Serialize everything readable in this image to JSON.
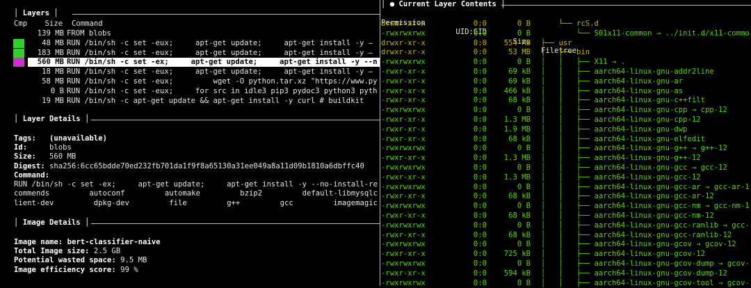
{
  "layers_panel": {
    "title": "Layers",
    "headers": {
      "cmp": "Cmp",
      "size": "Size",
      "command": "Command"
    },
    "rows": [
      {
        "size": "139 MB",
        "command": "FROM blobs",
        "cmp_color": "",
        "selected": false
      },
      {
        "size": "48 MB",
        "command": "RUN /bin/sh -c set -eux;     apt-get update;     apt-get install -y —",
        "cmp_color": "#33cc33",
        "selected": false
      },
      {
        "size": "183 MB",
        "command": "RUN /bin/sh -c set -eux;     apt-get update;     apt-get install -y —",
        "cmp_color": "#33cc33",
        "selected": false
      },
      {
        "size": "560 MB",
        "command": "RUN /bin/sh -c set -ex;     apt-get update;     apt-get install -y --n",
        "cmp_color": "#cc33cc",
        "selected": true
      },
      {
        "size": "18 MB",
        "command": "RUN /bin/sh -c set -eux;     apt-get update;     apt-get install -y —",
        "cmp_color": "",
        "selected": false
      },
      {
        "size": "58 MB",
        "command": "RUN /bin/sh -c set -eux;         wget -O python.tar.xz \"https://www.py",
        "cmp_color": "",
        "selected": false
      },
      {
        "size": "0 B",
        "command": "RUN /bin/sh -c set -eux;     for src in idle3 pip3 pydoc3 python3 pyth",
        "cmp_color": "",
        "selected": false
      },
      {
        "size": "19 MB",
        "command": "RUN /bin/sh -c apt-get update && apt-get install -y curl # buildkit",
        "cmp_color": "",
        "selected": false
      }
    ]
  },
  "layer_details": {
    "title": "Layer Details",
    "tags_label": "Tags:",
    "tags_value": "(unavailable)",
    "id_label": "Id:",
    "id_value": "blobs",
    "size_label": "Size:",
    "size_value": "560 MB",
    "digest_label": "Digest:",
    "digest_value": "sha256:6cc65bdde70ed232fb701da1f9f8a65130a31ee049a8a11d09b1810a6dbffc40",
    "command_label": "Command:",
    "command_lines": [
      "RUN /bin/sh -c set -ex;     apt-get update;     apt-get install -y --no-install-re",
      "commends         autoconf         automake         bzip2         default-libmysqlc",
      "lient-dev         dpkg-dev         file         g++         gcc         imagemagic"
    ]
  },
  "image_details": {
    "title": "Image Details",
    "name_label": "Image name:",
    "name_value": "bert-classifier-naive",
    "total_label": "Total Image size:",
    "total_value": "2.5 GB",
    "wasted_label": "Potential wasted space:",
    "wasted_value": "9.5 MB",
    "eff_label": "Image efficiency score:",
    "eff_value": "99 %"
  },
  "contents_panel": {
    "title": "● Current Layer Contents",
    "headers": {
      "permission": "Permission",
      "uid": "UID:GID",
      "size": "Size",
      "tree": "Filetree"
    },
    "rows": [
      {
        "perm": "drwxr-xr-x",
        "uid": "0:0",
        "size": "0 B",
        "tree": "    └── rcS.d",
        "color": "yellow"
      },
      {
        "perm": "-rwxrwxrwx",
        "uid": "0:0",
        "size": "0 B",
        "tree": "        └── S01x11-common → ../init.d/x11-commo",
        "color": "green"
      },
      {
        "perm": "drwxr-xr-x",
        "uid": "0:0",
        "size": "554 MB",
        "tree": "├── usr",
        "color": "yellow"
      },
      {
        "perm": "drwxr-xr-x",
        "uid": "0:0",
        "size": "53 MB",
        "tree": "│   ├── bin",
        "color": "yellow"
      },
      {
        "perm": "-rwxrwxrwx",
        "uid": "0:0",
        "size": "0 B",
        "tree": "│   │   ├── X11 → .",
        "color": "green"
      },
      {
        "perm": "-rwxr-xr-x",
        "uid": "0:0",
        "size": "69 kB",
        "tree": "│   │   ├── aarch64-linux-gnu-addr2line",
        "color": "green"
      },
      {
        "perm": "-rwxr-xr-x",
        "uid": "0:0",
        "size": "69 kB",
        "tree": "│   │   ├── aarch64-linux-gnu-ar",
        "color": "green"
      },
      {
        "perm": "-rwxr-xr-x",
        "uid": "0:0",
        "size": "466 kB",
        "tree": "│   │   ├── aarch64-linux-gnu-as",
        "color": "green"
      },
      {
        "perm": "-rwxr-xr-x",
        "uid": "0:0",
        "size": "68 kB",
        "tree": "│   │   ├── aarch64-linux-gnu-c++filt",
        "color": "green"
      },
      {
        "perm": "-rwxrwxrwx",
        "uid": "0:0",
        "size": "0 B",
        "tree": "│   │   ├── aarch64-linux-gnu-cpp → cpp-12",
        "color": "green"
      },
      {
        "perm": "-rwxr-xr-x",
        "uid": "0:0",
        "size": "1.3 MB",
        "tree": "│   │   ├── aarch64-linux-gnu-cpp-12",
        "color": "green"
      },
      {
        "perm": "-rwxr-xr-x",
        "uid": "0:0",
        "size": "1.9 MB",
        "tree": "│   │   ├── aarch64-linux-gnu-dwp",
        "color": "green"
      },
      {
        "perm": "-rwxr-xr-x",
        "uid": "0:0",
        "size": "68 kB",
        "tree": "│   │   ├── aarch64-linux-gnu-elfedit",
        "color": "green"
      },
      {
        "perm": "-rwxrwxrwx",
        "uid": "0:0",
        "size": "0 B",
        "tree": "│   │   ├── aarch64-linux-gnu-g++ → g++-12",
        "color": "green"
      },
      {
        "perm": "-rwxr-xr-x",
        "uid": "0:0",
        "size": "1.3 MB",
        "tree": "│   │   ├── aarch64-linux-gnu-g++-12",
        "color": "green"
      },
      {
        "perm": "-rwxrwxrwx",
        "uid": "0:0",
        "size": "0 B",
        "tree": "│   │   ├── aarch64-linux-gnu-gcc → gcc-12",
        "color": "green"
      },
      {
        "perm": "-rwxr-xr-x",
        "uid": "0:0",
        "size": "1.3 MB",
        "tree": "│   │   ├── aarch64-linux-gnu-gcc-12",
        "color": "green"
      },
      {
        "perm": "-rwxrwxrwx",
        "uid": "0:0",
        "size": "0 B",
        "tree": "│   │   ├── aarch64-linux-gnu-gcc-ar → gcc-ar-1",
        "color": "green"
      },
      {
        "perm": "-rwxr-xr-x",
        "uid": "0:0",
        "size": "68 kB",
        "tree": "│   │   ├── aarch64-linux-gnu-gcc-ar-12",
        "color": "green"
      },
      {
        "perm": "-rwxrwxrwx",
        "uid": "0:0",
        "size": "0 B",
        "tree": "│   │   ├── aarch64-linux-gnu-gcc-nm → gcc-nm-1",
        "color": "green"
      },
      {
        "perm": "-rwxr-xr-x",
        "uid": "0:0",
        "size": "68 kB",
        "tree": "│   │   ├── aarch64-linux-gnu-gcc-nm-12",
        "color": "green"
      },
      {
        "perm": "-rwxrwxrwx",
        "uid": "0:0",
        "size": "0 B",
        "tree": "│   │   ├── aarch64-linux-gnu-gcc-ranlib → gcc-",
        "color": "green"
      },
      {
        "perm": "-rwxr-xr-x",
        "uid": "0:0",
        "size": "68 kB",
        "tree": "│   │   ├── aarch64-linux-gnu-gcc-ranlib-12",
        "color": "green"
      },
      {
        "perm": "-rwxrwxrwx",
        "uid": "0:0",
        "size": "0 B",
        "tree": "│   │   ├── aarch64-linux-gnu-gcov → gcov-12",
        "color": "green"
      },
      {
        "perm": "-rwxr-xr-x",
        "uid": "0:0",
        "size": "725 kB",
        "tree": "│   │   ├── aarch64-linux-gnu-gcov-12",
        "color": "green"
      },
      {
        "perm": "-rwxrwxrwx",
        "uid": "0:0",
        "size": "0 B",
        "tree": "│   │   ├── aarch64-linux-gnu-gcov-dump → gcov-",
        "color": "green"
      },
      {
        "perm": "-rwxr-xr-x",
        "uid": "0:0",
        "size": "594 kB",
        "tree": "│   │   ├── aarch64-linux-gnu-gcov-dump-12",
        "color": "green"
      },
      {
        "perm": "-rwxrwxrwx",
        "uid": "0:0",
        "size": "0 B",
        "tree": "│   │   ├── aarch64-linux-gnu-gcov-tool → gcov-",
        "color": "green"
      }
    ]
  },
  "colors": {
    "yellow": "#c8b400",
    "green": "#5fd700",
    "selected_bg": "#ffffff"
  }
}
